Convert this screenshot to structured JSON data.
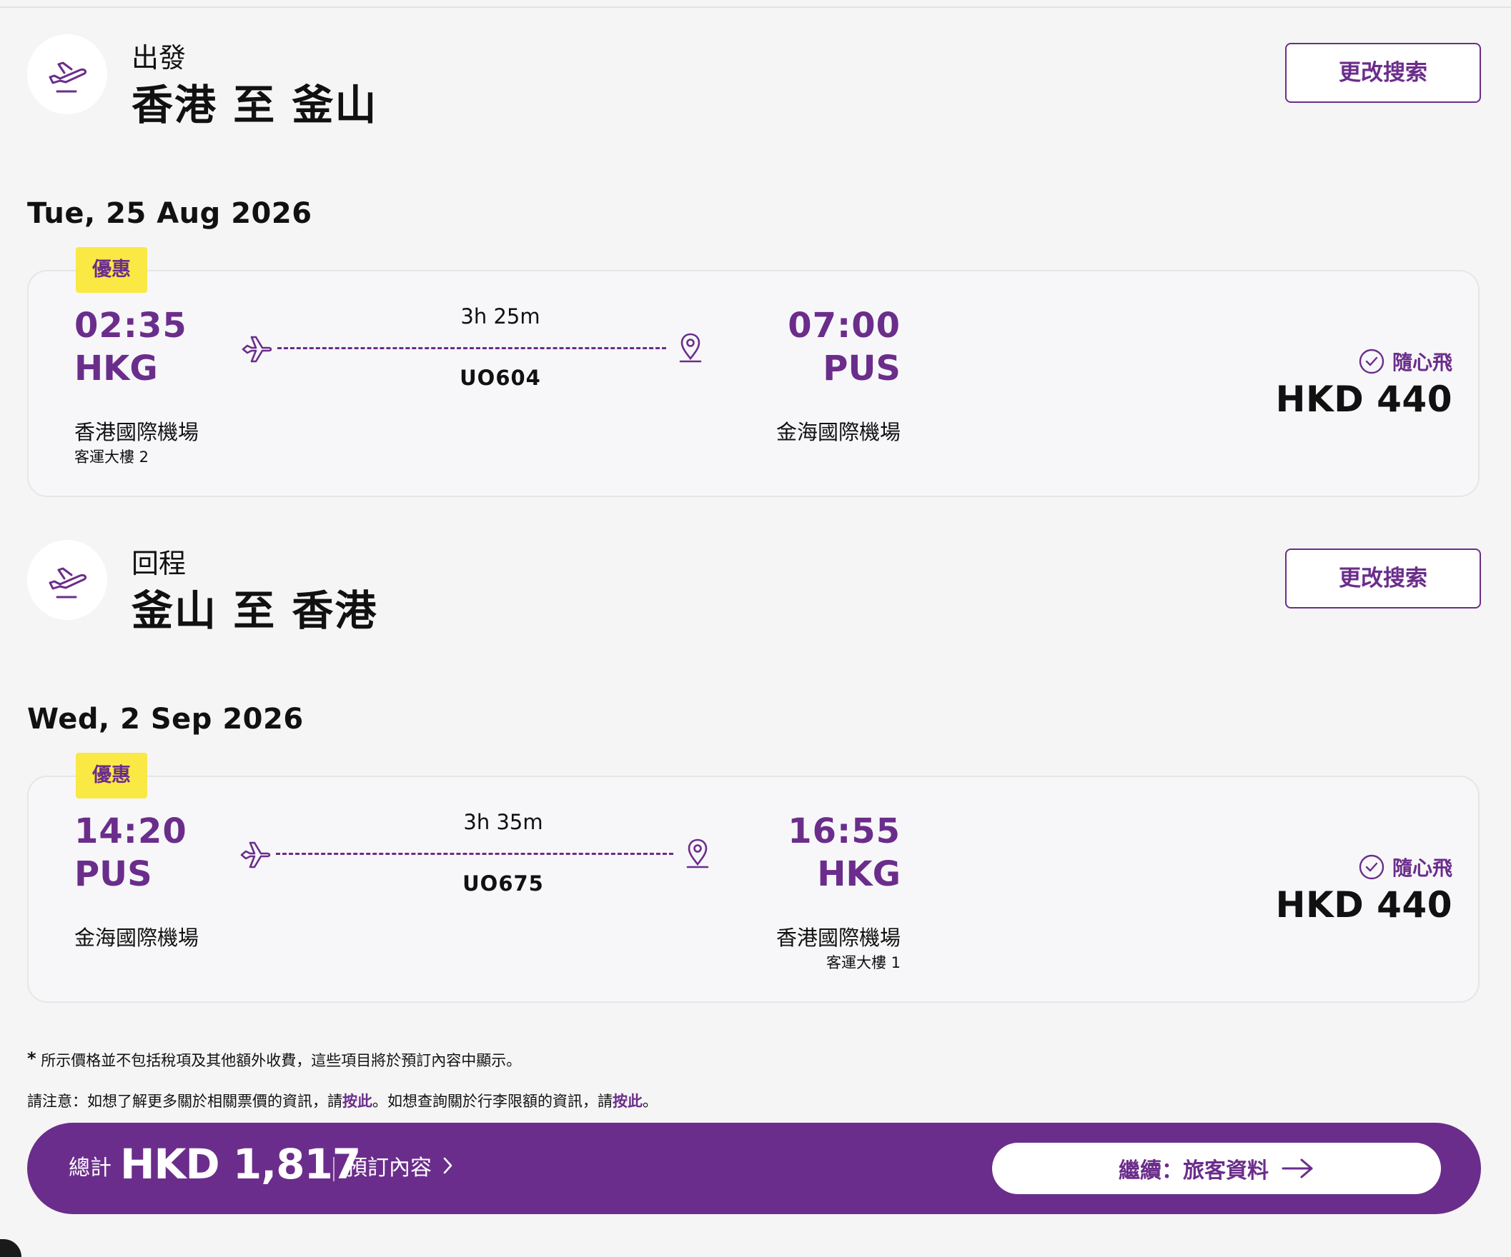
{
  "outbound": {
    "leg_label": "出發",
    "route": "香港 至 釜山",
    "modify_label": "更改搜索",
    "date": "Tue, 25 Aug 2026",
    "flight": {
      "promo": "優惠",
      "depart_time": "02:35",
      "depart_code": "HKG",
      "depart_airport": "香港國際機場",
      "depart_terminal": "客運大樓 2",
      "duration": "3h 25m",
      "flight_no": "UO604",
      "arrive_time": "07:00",
      "arrive_code": "PUS",
      "arrive_airport": "金海國際機場",
      "fare_type": "隨心飛",
      "price": "HKD 440"
    }
  },
  "return": {
    "leg_label": "回程",
    "route": "釜山 至 香港",
    "modify_label": "更改搜索",
    "date": "Wed, 2 Sep 2026",
    "flight": {
      "promo": "優惠",
      "depart_time": "14:20",
      "depart_code": "PUS",
      "depart_airport": "金海國際機場",
      "duration": "3h 35m",
      "flight_no": "UO675",
      "arrive_time": "16:55",
      "arrive_code": "HKG",
      "arrive_airport": "香港國際機場",
      "arrive_terminal": "客運大樓 1",
      "fare_type": "隨心飛",
      "price": "HKD 440"
    }
  },
  "notes": {
    "star": "*",
    "tax_note": "所示價格並不包括稅項及其他額外收費，這些項目將於預訂內容中顯示。",
    "fare_prefix": "請注意：如想了解更多關於相關票價的資訊，請",
    "fare_link": "按此",
    "baggage_text": "。如想查詢關於行李限額的資訊，請",
    "baggage_link": "按此",
    "end": "。"
  },
  "bottom_bar": {
    "total_label": "總計",
    "total_amount": "HKD 1,817",
    "summary_link": "預訂內容",
    "continue_label": "繼續：旅客資料"
  },
  "colors": {
    "brand_purple": "#6b2d8b",
    "promo_yellow": "#fae845",
    "background": "#f5f5f5"
  },
  "icons": {
    "leg": "plane-takeoff-icon",
    "departure": "plane-icon",
    "arrival": "location-pin-icon",
    "fare": "check-circle-icon",
    "summary": "chevron-right-icon",
    "continue": "arrow-right-icon"
  }
}
